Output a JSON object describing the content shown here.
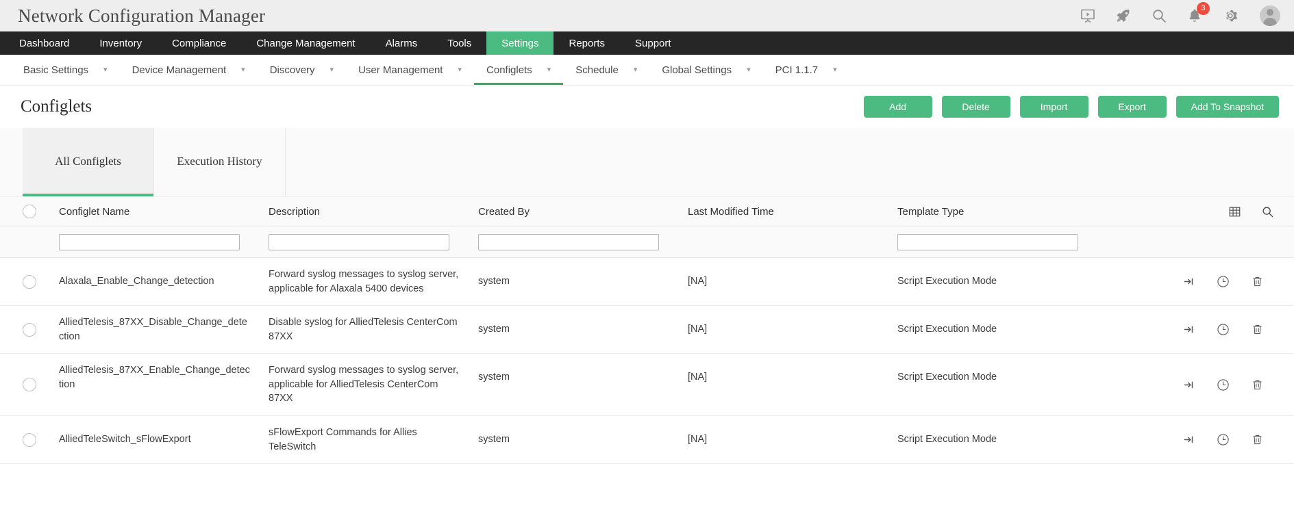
{
  "app": {
    "title": "Network Configuration Manager",
    "accent_green": "#4cbb82",
    "nav_dark": "#262626",
    "badge_red": "#f04b3f"
  },
  "topbar_icons": [
    {
      "name": "presentation-icon",
      "label": "Presentation"
    },
    {
      "name": "rocket-icon",
      "label": "Rocket"
    },
    {
      "name": "search-icon",
      "label": "Search"
    },
    {
      "name": "notification-bell-icon",
      "label": "Notifications",
      "badge": "3"
    },
    {
      "name": "gear-icon",
      "label": "Settings"
    },
    {
      "name": "avatar",
      "label": "User Profile"
    }
  ],
  "mainnav": [
    {
      "label": "Dashboard",
      "active": false
    },
    {
      "label": "Inventory",
      "active": false
    },
    {
      "label": "Compliance",
      "active": false
    },
    {
      "label": "Change Management",
      "active": false
    },
    {
      "label": "Alarms",
      "active": false
    },
    {
      "label": "Tools",
      "active": false
    },
    {
      "label": "Settings",
      "active": true
    },
    {
      "label": "Reports",
      "active": false
    },
    {
      "label": "Support",
      "active": false
    }
  ],
  "subnav": [
    {
      "label": "Basic Settings",
      "caret": true,
      "active": false
    },
    {
      "label": "Device Management",
      "caret": true,
      "active": false
    },
    {
      "label": "Discovery",
      "caret": true,
      "active": false
    },
    {
      "label": "User Management",
      "caret": true,
      "active": false
    },
    {
      "label": "Configlets",
      "caret": true,
      "active": true
    },
    {
      "label": "Schedule",
      "caret": true,
      "active": false
    },
    {
      "label": "Global Settings",
      "caret": true,
      "active": false
    },
    {
      "label": "PCI 1.1.7",
      "caret": true,
      "active": false
    }
  ],
  "page": {
    "title": "Configlets"
  },
  "action_buttons": [
    {
      "label": "Add",
      "name": "add-button"
    },
    {
      "label": "Delete",
      "name": "delete-button"
    },
    {
      "label": "Import",
      "name": "import-button"
    },
    {
      "label": "Export",
      "name": "export-button"
    },
    {
      "label": "Add To Snapshot",
      "name": "add-to-snapshot-button"
    }
  ],
  "tabs": [
    {
      "label": "All Configlets",
      "active": true
    },
    {
      "label": "Execution History",
      "active": false
    }
  ],
  "table": {
    "columns": [
      "Configlet Name",
      "Description",
      "Created By",
      "Last Modified Time",
      "Template Type"
    ],
    "header_icons": [
      {
        "name": "grid-columns-icon"
      },
      {
        "name": "search-icon"
      }
    ],
    "filters": {
      "configlet_name": "",
      "description": "",
      "created_by": "",
      "template_type": ""
    },
    "rows": [
      {
        "configlet_name": "Alaxala_Enable_Change_detection",
        "description": "Forward syslog messages to syslog server, applicable for Alaxala 5400 devices",
        "created_by": "system",
        "last_modified_time": "[NA]",
        "template_type": "Script Execution Mode"
      },
      {
        "configlet_name": "AlliedTelesis_87XX_Disable_Change_detection",
        "description": "Disable syslog for AlliedTelesis CenterCom 87XX",
        "created_by": "system",
        "last_modified_time": "[NA]",
        "template_type": "Script Execution Mode"
      },
      {
        "configlet_name": "AlliedTelesis_87XX_Enable_Change_detection",
        "description": "Forward syslog messages to syslog server, applicable for AlliedTelesis CenterCom 87XX",
        "created_by": "system",
        "last_modified_time": "[NA]",
        "template_type": "Script Execution Mode"
      },
      {
        "configlet_name": "AlliedTeleSwitch_sFlowExport",
        "description": "sFlowExport Commands for Allies TeleSwitch",
        "created_by": "system",
        "last_modified_time": "[NA]",
        "template_type": "Script Execution Mode"
      }
    ],
    "row_actions": [
      {
        "name": "execute-configlet-icon"
      },
      {
        "name": "history-clock-icon"
      },
      {
        "name": "delete-trash-icon"
      }
    ]
  }
}
